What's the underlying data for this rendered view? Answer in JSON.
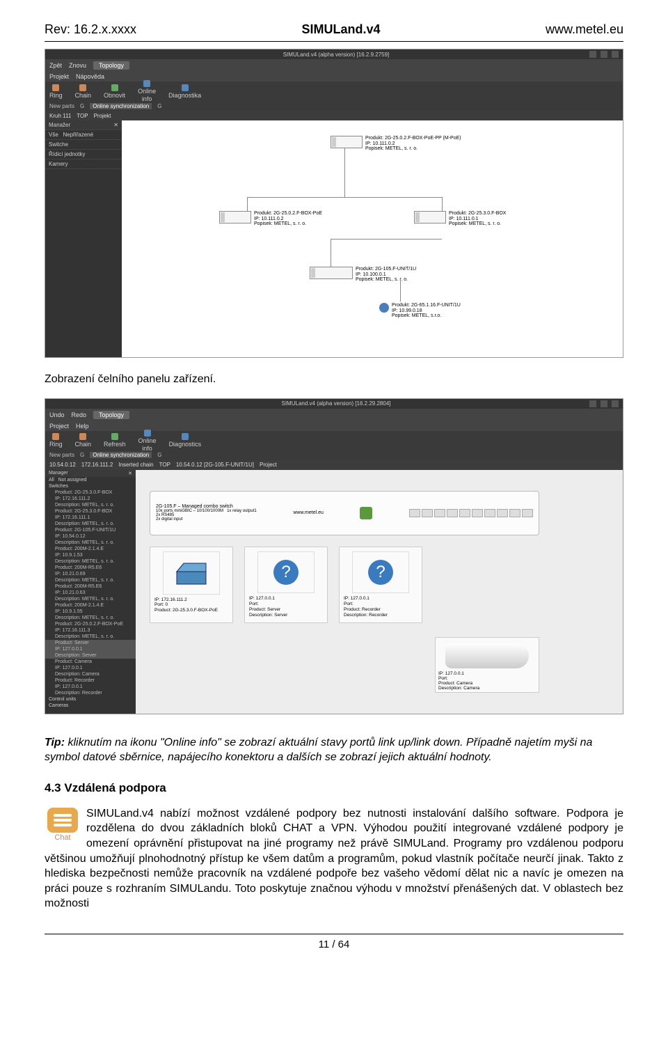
{
  "header": {
    "rev": "Rev: 16.2.x.xxxx",
    "title": "SIMULand.v4",
    "url": "www.metel.eu"
  },
  "shot1": {
    "title": "SIMULand.v4 (alpha version) [16.2.9.2759]",
    "tb1": {
      "zpet": "Zpět",
      "znovu": "Znovu",
      "topology": "Topology"
    },
    "tb1b": {
      "projekt": "Projekt",
      "napoveda": "Nápověda"
    },
    "tb2": {
      "ring": "Ring",
      "chain": "Chain",
      "obnovit": "Obnovit",
      "online": "Online",
      "info": "info",
      "diag": "Diagnostika"
    },
    "sub": {
      "newparts": "New parts",
      "sync": "Online synchronization"
    },
    "crumbs": [
      "Kruh 111",
      "TOP",
      "Projekt"
    ],
    "side": {
      "hdr": "Manažer",
      "vse": "Vše",
      "nep": "Nepřiřazené",
      "items": [
        "Switche",
        "Řídicí jednotky",
        "Kamery"
      ]
    },
    "nodes": {
      "n1": {
        "p": "Produkt: 2G-25.0.2.F-BOX-PoE-PP (M-PoE)",
        "ip": "IP: 10.111.0.2",
        "d": "Popisek: METEL, s. r. o."
      },
      "n2": {
        "p": "Produkt: 2G-25.0.2.F-BOX-PoE",
        "ip": "IP: 10.111.0.2",
        "d": "Popisek: METEL, s. r. o."
      },
      "n3": {
        "p": "Produkt: 2G-25.3.0.F-BOX",
        "ip": "IP: 10.111.0.1",
        "d": "Popisek: METEL, s. r. o."
      },
      "n4": {
        "p": "Produkt: 2G-105.F-UNIT/1U",
        "ip": "IP: 10.100.0.1",
        "d": "Popisek: METEL, s. r. o."
      },
      "n5": {
        "p": "Produkt: 2G-65.1.16.F-UNIT/1U",
        "ip": "IP: 10.99.0.18",
        "d": "Popisek: METEL, s.r.o."
      }
    }
  },
  "caption": "Zobrazení čelního panelu zařízení.",
  "shot2": {
    "title": "SIMULand.v4 (alpha version) [16.2.29.2804]",
    "tb1": {
      "undo": "Undo",
      "redo": "Redo",
      "topology": "Topology"
    },
    "tb1b": {
      "project": "Project",
      "help": "Help"
    },
    "tb2": {
      "ring": "Ring",
      "chain": "Chain",
      "refresh": "Refresh",
      "online": "Online",
      "info": "info",
      "diag": "Diagnostics"
    },
    "sub": {
      "newparts": "New parts",
      "sync": "Online synchronization"
    },
    "crumbs": [
      "10.54.0.12",
      "172.16.111.2",
      "Inserted chain",
      "TOP",
      "10.54.0.12 [2G-105.F-UNIT/1U]",
      "Project"
    ],
    "side": {
      "hdr": "Manager",
      "all": "All",
      "na": "Not assigned",
      "sw": "Switches",
      "items": [
        "Product: 2G-25.3.0.F-BOX",
        "IP: 172.16.111.2",
        "Description: METEL, s. r. o.",
        "Product: 2G-25.3.0.F-BOX",
        "IP: 172.16.111.1",
        "Description: METEL, s. r. o.",
        "Product: 2G-105.F-UNIT/1U",
        "IP: 10.54.0.12",
        "Description: METEL, s. r. o.",
        "Product: 200M-2.1.4.E",
        "IP: 10.9.1.53",
        "Description: METEL, s. r. o.",
        "Product: 200M-R5.E6",
        "IP: 10.21.0.69",
        "Description: METEL, s. r. o.",
        "Product: 200M-R5.E6",
        "IP: 10.21.0.63",
        "Description: METEL, s. r. o.",
        "Product: 200M-2.1.4.E",
        "IP: 10.9.1.55",
        "Description: METEL, s. r. o.",
        "Product: 2G-25.0.2.F-BOX-PoE",
        "IP: 172.16.111.3",
        "Description: METEL, s. r. o.",
        "Product: Server",
        "IP: 127.0.0.1",
        "Description: Server",
        "Product: Camera",
        "IP: 127.0.0.1",
        "Description: Camera",
        "Product: Recorder",
        "IP: 127.0.0.1",
        "Description: Recorder"
      ],
      "foot": [
        "Control units",
        "Cameras"
      ]
    },
    "panel": {
      "t": "2G-105.F – Managed combo switch",
      "s1": "10x ports miniGBIC – 10/100/1000M",
      "s2": "1x relay output1",
      "s3": "2x RS485",
      "s4": "2x digital input",
      "url": "www.metel.eu"
    },
    "cards": {
      "c1": {
        "ip": "IP: 172.16.111.2",
        "port": "Port: 0",
        "prod": "Product: 2G-25.3.0.F-BOX-PoE"
      },
      "c2": {
        "ip": "IP: 127.0.0.1",
        "port": "Port:",
        "prod": "Product: Server",
        "desc": "Description: Server"
      },
      "c3": {
        "ip": "IP: 127.0.0.1",
        "port": "Port:",
        "prod": "Product: Recorder",
        "desc": "Description: Recorder"
      },
      "cam": {
        "ip": "IP: 127.0.0.1",
        "port": "Port:",
        "prod": "Product: Camera",
        "desc": "Description: Camera"
      }
    }
  },
  "tip": {
    "t1": "Tip: kliknutím na ikonu \"Online info\" se zobrazí aktuální stavy portů link up/link down. Případně najetím myši na symbol datové sběrnice, napájecího konektoru a dalších se zobrazí jejich aktuální hodnoty."
  },
  "section": {
    "h": "4.3 Vzdálená podpora"
  },
  "chat": {
    "label": "Chat"
  },
  "para1": "SIMULand.v4 nabízí možnost vzdálené podpory bez nutnosti instalování dalšího software. Podpora je rozdělena do dvou základních bloků CHAT a VPN. Výhodou použití integrované vzdálené podpory je omezení oprávnění přistupovat na jiné programy než právě SIMULand. Programy pro vzdálenou podporu většinou umožňují plnohodnotný přístup ke všem datům a programům, pokud vlastník počítače neurčí jinak. Takto z hlediska bezpečnosti nemůže pracovník na vzdálené podpoře bez vašeho vědomí dělat nic a navíc je omezen na práci pouze s rozhraním SIMULandu. Toto poskytuje značnou výhodu v množství přenášených dat. V oblastech bez možnosti",
  "footer": "11 / 64"
}
